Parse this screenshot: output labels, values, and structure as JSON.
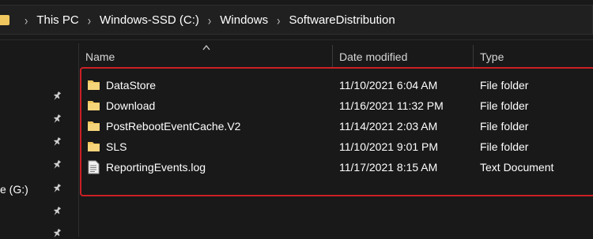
{
  "address_bar": {
    "breadcrumbs": [
      "This PC",
      "Windows-SSD (C:)",
      "Windows",
      "SoftwareDistribution"
    ],
    "separator": "›"
  },
  "nav_pane": {
    "drive_label": "e (G:)"
  },
  "columns": {
    "name": "Name",
    "date_modified": "Date modified",
    "type": "Type"
  },
  "files": [
    {
      "name": "DataStore",
      "date": "11/10/2021 6:04 AM",
      "type": "File folder",
      "icon": "folder-icon"
    },
    {
      "name": "Download",
      "date": "11/16/2021 11:32 PM",
      "type": "File folder",
      "icon": "folder-icon"
    },
    {
      "name": "PostRebootEventCache.V2",
      "date": "11/14/2021 2:03 AM",
      "type": "File folder",
      "icon": "folder-icon"
    },
    {
      "name": "SLS",
      "date": "11/10/2021 9:01 PM",
      "type": "File folder",
      "icon": "folder-icon"
    },
    {
      "name": "ReportingEvents.log",
      "date": "11/17/2021 8:15 AM",
      "type": "Text Document",
      "icon": "text-file-icon"
    }
  ],
  "colors": {
    "background": "#191919",
    "folder": "#f0c75e",
    "highlight": "#cc1f25"
  }
}
